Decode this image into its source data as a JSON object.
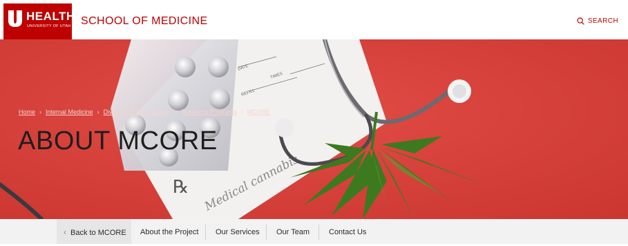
{
  "header": {
    "logo_word": "HEALTH",
    "logo_sub": "UNIVERSITY OF UTAH",
    "school": "SCHOOL OF MEDICINE",
    "search_label": "SEARCH"
  },
  "hero": {
    "breadcrumb": [
      "Home",
      "Internal Medicine",
      "Division of Epidemiology",
      "Research Programs",
      "MCORE"
    ],
    "title": "ABOUT MCORE",
    "image_text": {
      "date": "DATE",
      "times": "TIMES",
      "refill": "REFILL",
      "rx": "℞",
      "script": "Medical cannabis"
    }
  },
  "subnav": {
    "back": "Back to MCORE",
    "items": [
      "About the Project",
      "Our Services",
      "Our Team",
      "Contact Us"
    ]
  },
  "colors": {
    "brand": "#be0000",
    "hero_bg": "#e8453e",
    "subnav_bg": "#f2f2f2"
  }
}
